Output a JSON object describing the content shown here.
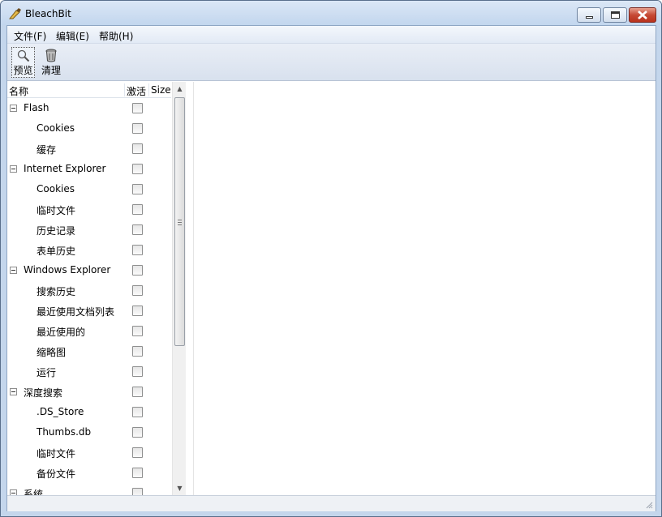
{
  "window": {
    "title": "BleachBit",
    "icon": "bleachbit-app-icon"
  },
  "menu": {
    "items": [
      "文件(F)",
      "编辑(E)",
      "帮助(H)"
    ]
  },
  "toolbar": {
    "preview_label": "预览",
    "preview_icon": "magnifier-icon",
    "clean_label": "清理",
    "clean_icon": "trash-can-icon"
  },
  "tree": {
    "headers": {
      "name": "名称",
      "active": "激活",
      "size": "Size"
    },
    "rows": [
      {
        "label": "Flash",
        "level": 0,
        "expandable": true,
        "checked": false
      },
      {
        "label": "Cookies",
        "level": 1,
        "expandable": false,
        "checked": false
      },
      {
        "label": "缓存",
        "level": 1,
        "expandable": false,
        "checked": false
      },
      {
        "label": "Internet Explorer",
        "level": 0,
        "expandable": true,
        "checked": false
      },
      {
        "label": "Cookies",
        "level": 1,
        "expandable": false,
        "checked": false
      },
      {
        "label": "临时文件",
        "level": 1,
        "expandable": false,
        "checked": false
      },
      {
        "label": "历史记录",
        "level": 1,
        "expandable": false,
        "checked": false
      },
      {
        "label": "表单历史",
        "level": 1,
        "expandable": false,
        "checked": false
      },
      {
        "label": "Windows Explorer",
        "level": 0,
        "expandable": true,
        "checked": false
      },
      {
        "label": "搜索历史",
        "level": 1,
        "expandable": false,
        "checked": false
      },
      {
        "label": "最近使用文档列表",
        "level": 1,
        "expandable": false,
        "checked": false
      },
      {
        "label": "最近使用的",
        "level": 1,
        "expandable": false,
        "checked": false
      },
      {
        "label": "缩略图",
        "level": 1,
        "expandable": false,
        "checked": false
      },
      {
        "label": "运行",
        "level": 1,
        "expandable": false,
        "checked": false
      },
      {
        "label": "深度搜索",
        "level": 0,
        "expandable": true,
        "checked": false
      },
      {
        "label": ".DS_Store",
        "level": 1,
        "expandable": false,
        "checked": false
      },
      {
        "label": "Thumbs.db",
        "level": 1,
        "expandable": false,
        "checked": false
      },
      {
        "label": "临时文件",
        "level": 1,
        "expandable": false,
        "checked": false
      },
      {
        "label": "备份文件",
        "level": 1,
        "expandable": false,
        "checked": false
      },
      {
        "label": "系统",
        "level": 0,
        "expandable": true,
        "checked": false
      }
    ]
  },
  "colors": {
    "accent": "#c4d6ec",
    "close_button": "#c64a35"
  }
}
